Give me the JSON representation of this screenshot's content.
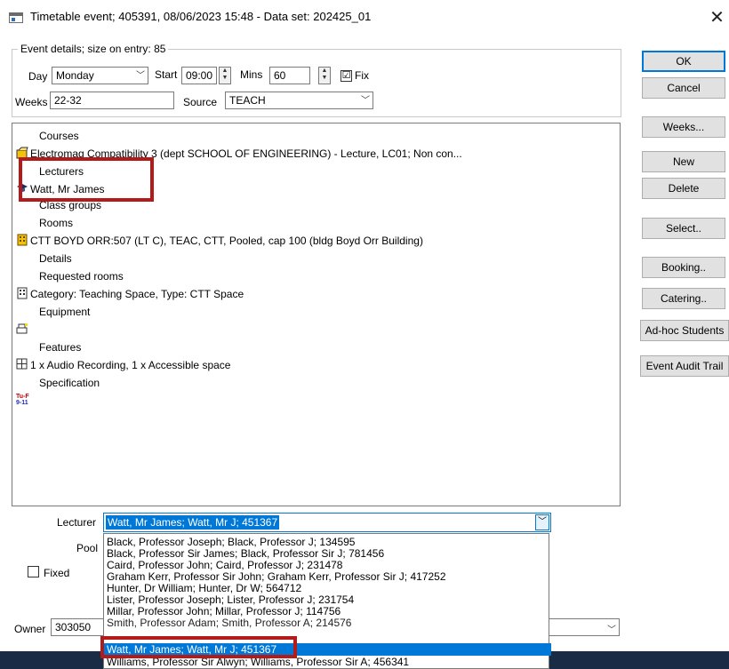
{
  "window": {
    "title": "Timetable event; 405391, 08/06/2023 15:48  -  Data set: 202425_01"
  },
  "details": {
    "legend": "Event details; size on entry: 85",
    "day_label": "Day",
    "day_value": "Monday",
    "start_label": "Start",
    "start_value": "09:00",
    "mins_label": "Mins",
    "mins_value": "60",
    "fix_label": "Fix",
    "fix_checked": "☑",
    "weeks_label": "Weeks",
    "weeks_value": "22-32",
    "source_label": "Source",
    "source_value": "TEACH"
  },
  "tree": {
    "courses_header": "Courses",
    "course_item": "Electromag Compatibility 3 (dept SCHOOL OF ENGINEERING) - Lecture, LC01; Non con...",
    "lecturers_header": "Lecturers",
    "lecturer_item": "Watt, Mr James",
    "class_groups_header": "Class groups",
    "rooms_header": "Rooms",
    "room_item": "CTT BOYD ORR:507 (LT C), TEAC, CTT, Pooled, cap 100 (bldg Boyd Orr Building)",
    "details_header": "Details",
    "requested_rooms_header": "Requested rooms",
    "requested_room_item": "Category: Teaching Space, Type: CTT Space",
    "equipment_header": "Equipment",
    "features_header": "Features",
    "feature_item": "1 x Audio Recording, 1 x Accessible space",
    "specification_header": "Specification",
    "spec_icon_top": "Tu-F",
    "spec_icon_bottom": "9-11"
  },
  "bottom": {
    "lecturer_label": "Lecturer",
    "lecturer_value": "Watt, Mr James; Watt, Mr J; 451367",
    "pool_label": "Pool",
    "fixed_label": "Fixed",
    "owner_label": "Owner",
    "owner_value": "303050"
  },
  "dropdown_options": [
    "Black, Professor Joseph; Black, Professor J; 134595",
    "Black, Professor Sir James; Black, Professor Sir J; 781456",
    "Caird, Professor John; Caird, Professor J; 231478",
    "Graham Kerr, Professor Sir John; Graham Kerr, Professor Sir J; 417252",
    "Hunter, Dr William; Hunter, Dr W; 564712",
    "Lister, Professor Joseph; Lister, Professor J; 231754",
    "Millar, Professor John; Millar, Professor J; 114756",
    "Smith, Professor Adam; Smith, Professor A; 214576",
    "Watt, Mr James; Watt, Mr J; 451367",
    "Williams, Professor Sir Alwyn; Williams, Professor Sir A; 456341"
  ],
  "buttons": {
    "ok": "OK",
    "cancel": "Cancel",
    "weeks": "Weeks...",
    "new": "New",
    "delete": "Delete",
    "select": "Select..",
    "booking": "Booking..",
    "catering": "Catering..",
    "adhoc": "Ad-hoc Students",
    "audit": "Event Audit Trail"
  },
  "colors": {
    "highlight_box": "#b31a1a",
    "selection": "#0078d7"
  }
}
